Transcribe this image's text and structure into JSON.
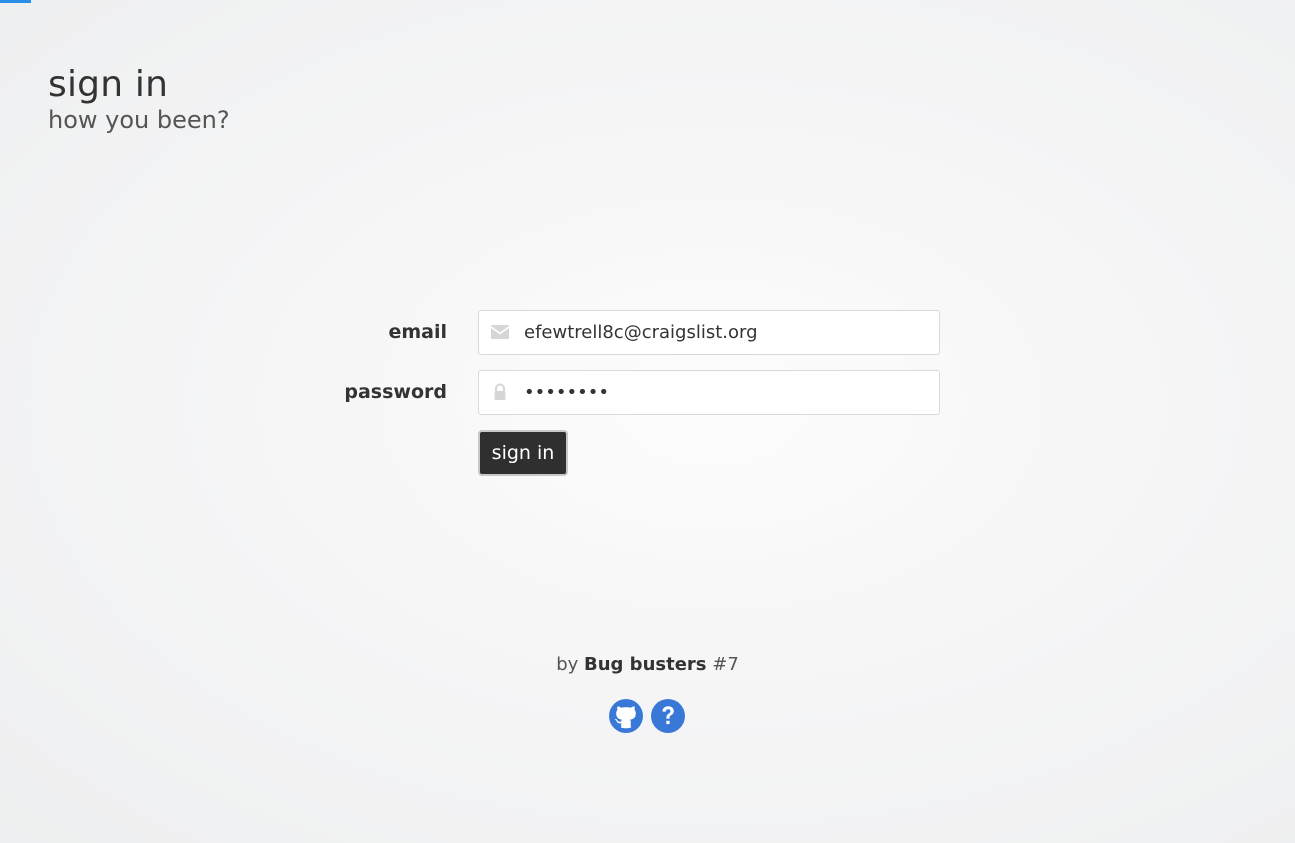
{
  "header": {
    "title": "sign in",
    "subtitle": "how you been?"
  },
  "form": {
    "email": {
      "label": "email",
      "value": "efewtrell8c@craigslist.org",
      "icon": "envelope-icon"
    },
    "password": {
      "label": "password",
      "value": "••••••••",
      "icon": "lock-icon"
    },
    "submit_label": "sign in"
  },
  "footer": {
    "by": "by",
    "team": "Bug busters",
    "number": "#7",
    "icons": [
      "github-icon",
      "help-icon"
    ]
  },
  "colors": {
    "accent": "#2b8fe8",
    "button_bg": "#2f2f2f",
    "icon_blue": "#3a78d8"
  }
}
